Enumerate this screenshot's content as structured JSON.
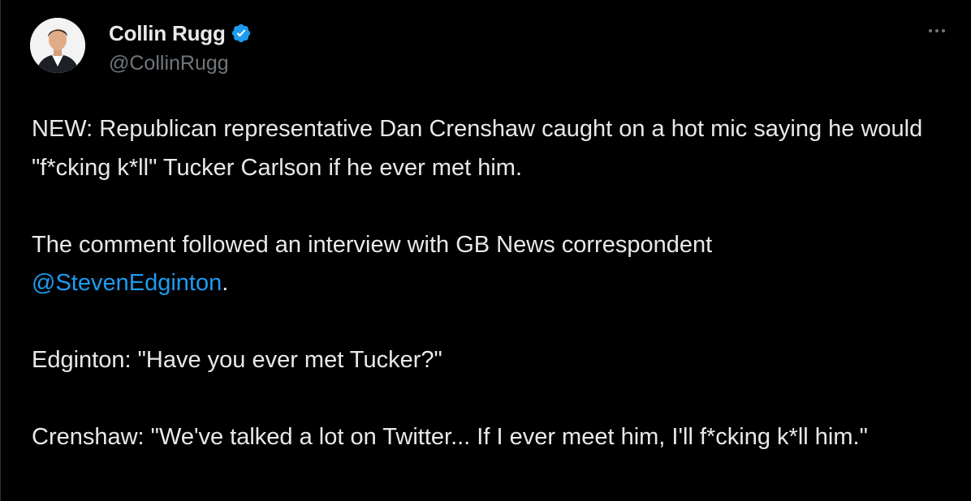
{
  "author": {
    "display_name": "Collin Rugg",
    "handle": "@CollinRugg",
    "verified": true,
    "avatar_icon": "profile-photo"
  },
  "menu": {
    "icon": "more-options-icon"
  },
  "tweet": {
    "p1": "NEW: Republican representative Dan Crenshaw caught on a hot mic saying he would \"f*cking k*ll\" Tucker Carlson if he ever met him.",
    "p2_before": "The comment followed an interview with GB News correspondent ",
    "p2_mention": "@StevenEdginton",
    "p2_after": ".",
    "p3": "Edginton: \"Have you ever met Tucker?\"",
    "p4": "Crenshaw: \"We've talked a lot on Twitter... If I ever meet him, I'll f*cking k*ll him.\""
  },
  "colors": {
    "background": "#000000",
    "text": "#e7e9ea",
    "secondary_text": "#71767b",
    "link": "#1d9bf0",
    "verified_badge": "#1d9bf0"
  }
}
